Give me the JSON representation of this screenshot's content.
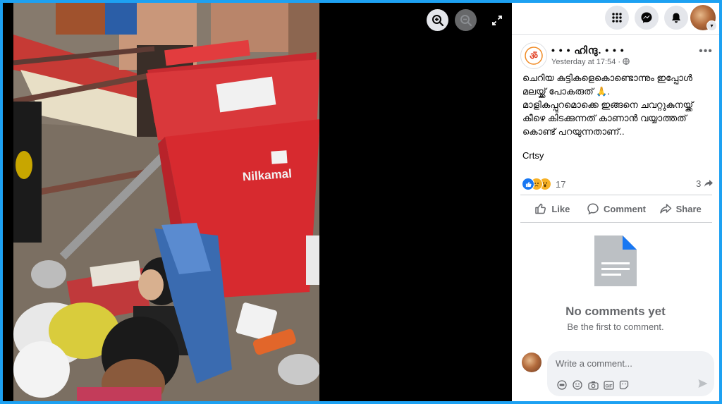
{
  "viewer": {
    "photo_logo_text": "Nilkamal",
    "icons": [
      "zoom-in-icon",
      "zoom-out-icon",
      "expand-icon"
    ]
  },
  "topbar": {
    "icons": [
      "menu-grid-icon",
      "messenger-icon",
      "bell-icon",
      "profile-avatar"
    ]
  },
  "post": {
    "page_name": "• • • ഹിന്ദു. • • •",
    "time": "Yesterday at 17:54 ·",
    "text_lines": [
      "ചെറിയ കുട്ടികളെകൊണ്ടൊന്നും ഇപ്പോൾ മലയ്ക്ക് പോകരുത് 🙏.",
      "മാളികപ്പുറമൊക്കെ ഇങ്ങനെ ചവറ്റുകുനയ്ക്ക് കീഴെ കിടക്കുന്നത് കാണാൻ വയ്യാത്തത് കൊണ്ട് പറയുന്നതാണ്.."
    ],
    "credit": "Crtsy",
    "reaction_count": "17",
    "share_count": "3",
    "actions": {
      "like": "Like",
      "comment": "Comment",
      "share": "Share"
    }
  },
  "comments": {
    "empty_title": "No comments yet",
    "empty_subtitle": "Be the first to comment.",
    "placeholder": "Write a comment..."
  },
  "colors": {
    "frame_border": "#1da1f2",
    "muted_text": "#65676b",
    "like_blue": "#1877f2",
    "bin_red": "#d72a2f"
  }
}
